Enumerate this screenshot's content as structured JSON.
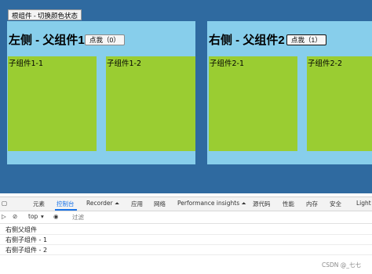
{
  "root": {
    "toggle_button": "根组件 - 切换颜色状态"
  },
  "left": {
    "title": "左侧 - 父组件1",
    "click_button": "点我（0）",
    "children": [
      "子组件1-1",
      "子组件1-2"
    ]
  },
  "right": {
    "title": "右侧 - 父组件2",
    "click_button": "点我（1）",
    "children": [
      "子组件2-1",
      "子组件2-2"
    ]
  },
  "devtools": {
    "tabs": [
      "元素",
      "控制台",
      "Recorder ⏶",
      "应用",
      "网络",
      "Performance insights ⏶",
      "源代码",
      "性能",
      "内存",
      "安全",
      "Light"
    ],
    "active_tab": "控制台",
    "toolbar": {
      "context": "top",
      "filter_placeholder": "过滤"
    },
    "console_lines": [
      "右侧父组件",
      "右侧子组件 - 1",
      "右侧子组件 - 2"
    ]
  },
  "watermark": "CSDN @_七七",
  "colors": {
    "page_bg": "#2f6aa0",
    "panel_bg": "#87ceeb",
    "child_bg": "#9acd32",
    "active_tab": "#1a73e8"
  }
}
